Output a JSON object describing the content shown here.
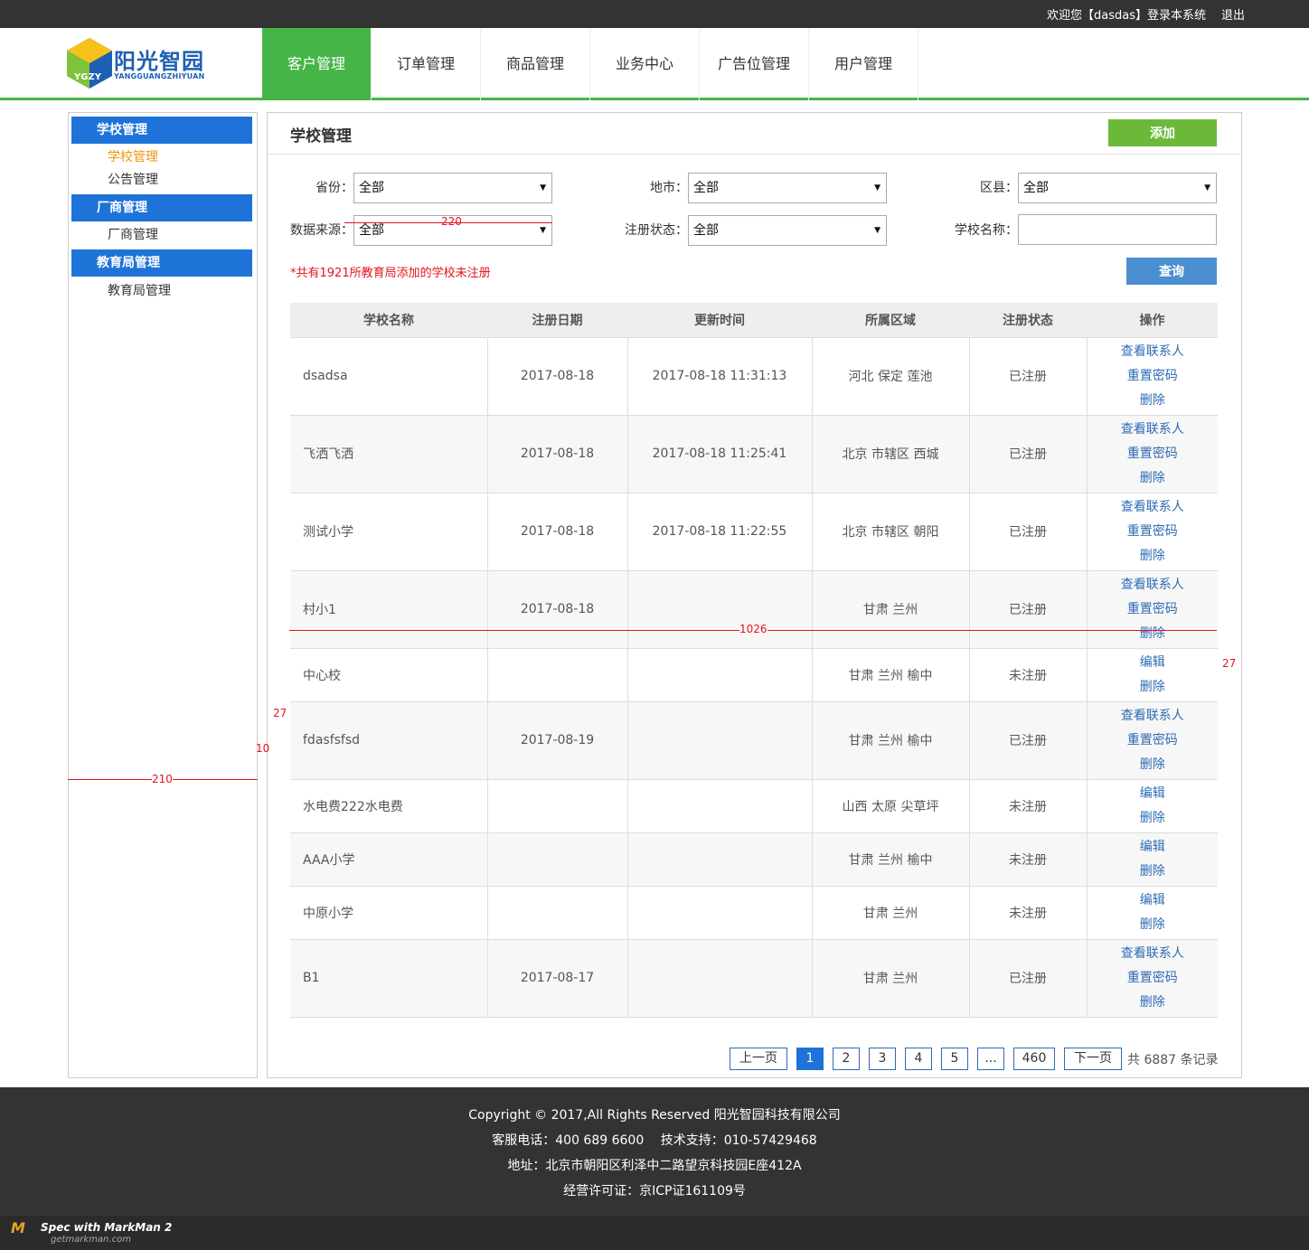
{
  "topbar": {
    "welcome": "欢迎您【dasdas】登录本系统",
    "logout": "退出"
  },
  "logo": {
    "cn": "阳光智园",
    "en": "YANGGUANGZHIYUAN",
    "badge": "YGZY"
  },
  "nav": [
    "客户管理",
    "订单管理",
    "商品管理",
    "业务中心",
    "广告位管理",
    "用户管理"
  ],
  "sidebar": {
    "groups": [
      {
        "title": "学校管理",
        "items": [
          "学校管理",
          "公告管理"
        ]
      },
      {
        "title": "厂商管理",
        "items": [
          "厂商管理"
        ]
      },
      {
        "title": "教育局管理",
        "items": [
          "教育局管理"
        ]
      }
    ]
  },
  "main": {
    "title": "学校管理",
    "add": "添加"
  },
  "filters": {
    "province_label": "省份：",
    "province_value": "全部",
    "city_label": "地市：",
    "city_value": "全部",
    "district_label": "区县：",
    "district_value": "全部",
    "source_label": "数据来源：",
    "source_value": "全部",
    "status_label": "注册状态：",
    "status_value": "全部",
    "school_label": "学校名称：",
    "school_placeholder": "",
    "query": "查询"
  },
  "note": "*共有1921所教育局添加的学校未注册",
  "table": {
    "headers": [
      "学校名称",
      "注册日期",
      "更新时间",
      "所属区域",
      "注册状态",
      "操作"
    ],
    "rows": [
      {
        "name": "dsadsa",
        "date": "2017-08-18",
        "updated": "2017-08-18 11:31:13",
        "region": "河北 保定 莲池",
        "status": "已注册",
        "actions": [
          "查看联系人",
          "重置密码",
          "删除"
        ]
      },
      {
        "name": "飞洒飞洒",
        "date": "2017-08-18",
        "updated": "2017-08-18 11:25:41",
        "region": "北京 市辖区 西城",
        "status": "已注册",
        "actions": [
          "查看联系人",
          "重置密码",
          "删除"
        ]
      },
      {
        "name": "测试小学",
        "date": "2017-08-18",
        "updated": "2017-08-18 11:22:55",
        "region": "北京 市辖区 朝阳",
        "status": "已注册",
        "actions": [
          "查看联系人",
          "重置密码",
          "删除"
        ]
      },
      {
        "name": "村小1",
        "date": "2017-08-18",
        "updated": "",
        "region": "甘肃 兰州",
        "status": "已注册",
        "actions": [
          "查看联系人",
          "重置密码",
          "删除"
        ]
      },
      {
        "name": "中心校",
        "date": "",
        "updated": "",
        "region": "甘肃 兰州 榆中",
        "status": "未注册",
        "actions": [
          "编辑",
          "删除"
        ]
      },
      {
        "name": "fdasfsfsd",
        "date": "2017-08-19",
        "updated": "",
        "region": "甘肃 兰州 榆中",
        "status": "已注册",
        "actions": [
          "查看联系人",
          "重置密码",
          "删除"
        ]
      },
      {
        "name": "水电费222水电费",
        "date": "",
        "updated": "",
        "region": "山西 太原 尖草坪",
        "status": "未注册",
        "actions": [
          "编辑",
          "删除"
        ]
      },
      {
        "name": "AAA小学",
        "date": "",
        "updated": "",
        "region": "甘肃 兰州 榆中",
        "status": "未注册",
        "actions": [
          "编辑",
          "删除"
        ]
      },
      {
        "name": "中原小学",
        "date": "",
        "updated": "",
        "region": "甘肃 兰州",
        "status": "未注册",
        "actions": [
          "编辑",
          "删除"
        ]
      },
      {
        "name": "B1",
        "date": "2017-08-17",
        "updated": "",
        "region": "甘肃 兰州",
        "status": "已注册",
        "actions": [
          "查看联系人",
          "重置密码",
          "删除"
        ]
      }
    ]
  },
  "pager": {
    "prev": "上一页",
    "pages": [
      "1",
      "2",
      "3",
      "4",
      "5",
      "...",
      "460"
    ],
    "current": "1",
    "next": "下一页",
    "total": "共 6887 条记录"
  },
  "footer": {
    "copyright": "Copyright © 2017,All Rights Reserved 阳光智园科技有限公司",
    "phone": "客服电话：400 689 6600　 技术支持：010-57429468",
    "address": "地址：北京市朝阳区利泽中二路望京科技园E座412A",
    "license": "经营许可证：京ICP证161109号"
  },
  "markman": {
    "logo": "M",
    "title": "Spec with MarkMan 2",
    "url": "getmarkman.com"
  },
  "annotations": [
    "220",
    "1026",
    "27",
    "27",
    "10",
    "210"
  ],
  "colors": {
    "accent_green": "#46b548",
    "sidebar_blue": "#1e73d8",
    "link_blue": "#2d6bb5",
    "warning_red": "#e3141e",
    "add_green": "#6bb83a"
  }
}
